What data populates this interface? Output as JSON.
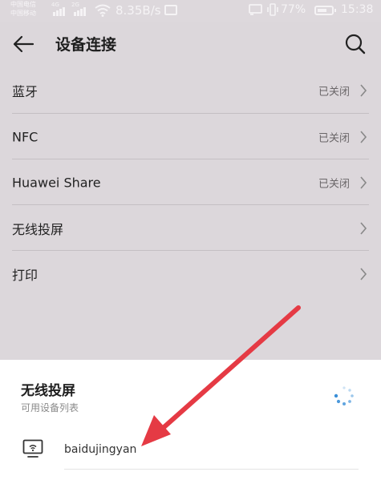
{
  "status_bar": {
    "carrier_top": "中国电信",
    "carrier_bottom": "中国移动",
    "network": "4G",
    "network2": "2G",
    "speed": "8.35B/s",
    "battery": "77%",
    "time": "15:38"
  },
  "title_bar": {
    "back_icon": "back-arrow-icon",
    "title": "设备连接",
    "search_icon": "search-icon"
  },
  "settings": {
    "rows": [
      {
        "label": "蓝牙",
        "status": "已关闭"
      },
      {
        "label": "NFC",
        "status": "已关闭"
      },
      {
        "label": "Huawei Share",
        "status": "已关闭"
      },
      {
        "label": "无线投屏",
        "status": ""
      },
      {
        "label": "打印",
        "status": ""
      }
    ]
  },
  "sheet": {
    "title": "无线投屏",
    "subtitle": "可用设备列表",
    "device_icon": "cast-screen-icon",
    "devices": [
      {
        "name": "baidujingyan"
      }
    ]
  },
  "colors": {
    "dim_background": "#dcd7db",
    "sheet_background": "#ffffff",
    "annotation_arrow": "#e53a44",
    "spinner": "#3a8fd8"
  }
}
